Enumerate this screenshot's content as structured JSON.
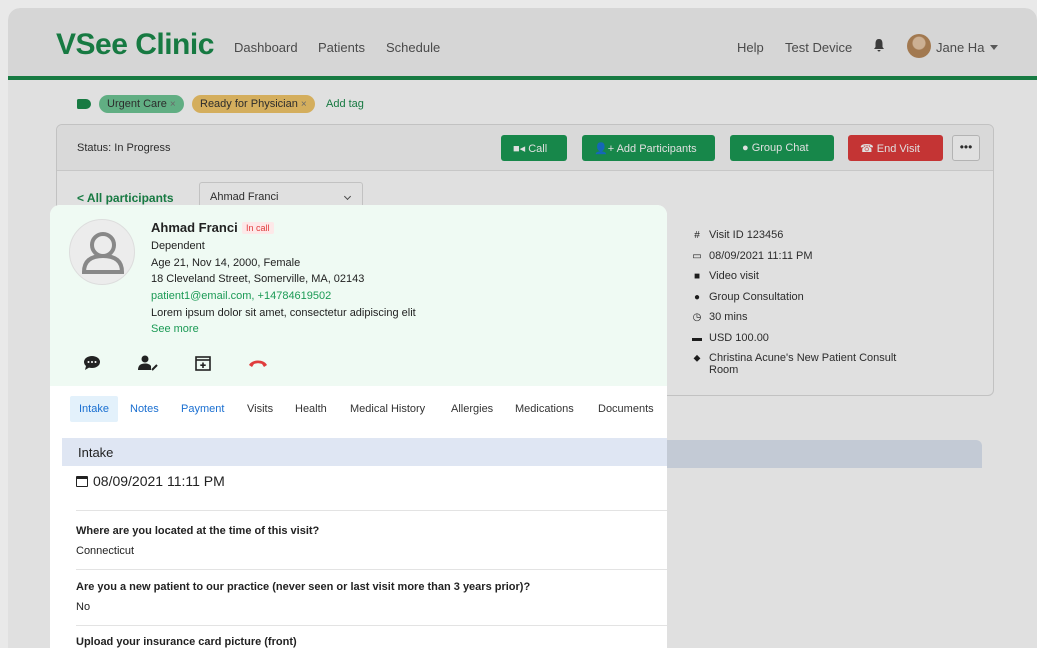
{
  "app": {
    "logo": "VSee Clinic",
    "nav": [
      "Dashboard",
      "Patients",
      "Schedule"
    ],
    "help": "Help",
    "test_device": "Test Device",
    "user": "Jane Ha"
  },
  "tags": {
    "items": [
      "Urgent Care",
      "Ready for Physician"
    ],
    "add_label": "Add tag"
  },
  "visit": {
    "status": "Status: In Progress",
    "buttons": {
      "call": "Call",
      "add_participants": "Add Participants",
      "group_chat": "Group Chat",
      "end_visit": "End Visit",
      "more": "•••"
    },
    "all_participants": "< All participants",
    "selected_participant": "Ahmad Franci",
    "info": {
      "visit_id": "Visit ID 123456",
      "datetime": "08/09/2021 11:11 PM",
      "type": "Video visit",
      "consult": "Group Consultation",
      "duration": "30 mins",
      "price": "USD 100.00",
      "room_line1": "Christina Acune's New Patient Consult",
      "room_line2": "Room"
    }
  },
  "patient": {
    "name": "Ahmad Franci",
    "badge": "In call",
    "relation": "Dependent",
    "demographics": "Age 21, Nov 14, 2000, Female",
    "address": "18 Cleveland Street, Somerville, MA, 02143",
    "contact": "patient1@email.com, +14784619502",
    "note": "Lorem ipsum dolor sit amet, consectetur adipiscing elit",
    "see_more": "See more"
  },
  "tabs": [
    "Intake",
    "Notes",
    "Payment",
    "Visits",
    "Health",
    "Medical History",
    "Allergies",
    "Medications",
    "Documents"
  ],
  "intake": {
    "header": "Intake",
    "date": "08/09/2021  11:11 PM",
    "q1": "Where are you located at the time of this visit?",
    "a1": "Connecticut",
    "q2": "Are you a new patient to our practice (never seen or last visit more than 3 years prior)?",
    "a2": "No",
    "q3": "Upload your insurance card picture (front)"
  },
  "colors": {
    "brand": "#1b8b4c",
    "danger": "#e03c3c",
    "link": "#1a6fd1",
    "patient_card_bg": "#effaf3"
  }
}
